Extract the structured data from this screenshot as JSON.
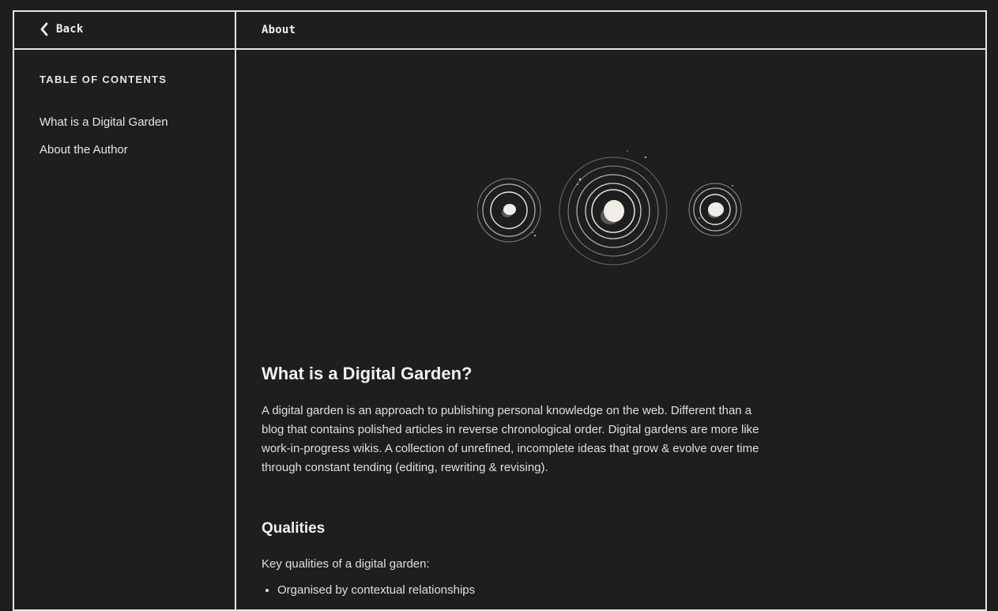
{
  "nav": {
    "back_label": "Back",
    "page_tab": "About"
  },
  "toc": {
    "heading": "TABLE OF CONTENTS",
    "items": [
      "What is a Digital Garden",
      "About the Author"
    ]
  },
  "article": {
    "title": "What is a Digital Garden?",
    "intro": "A digital garden is an approach to publishing personal knowledge on the web. Different than a blog that contains polished articles in reverse chronological order. Digital gardens are more like work-in-progress wikis. A collection of unrefined, incomplete ideas that grow & evolve over time through constant tending (editing, rewriting & revising).",
    "qualities_heading": "Qualities",
    "qualities_intro": "Key qualities of a digital garden:",
    "qualities": [
      "Organised by contextual relationships"
    ]
  },
  "hero": {
    "icon": "orbiting-planets-illustration"
  },
  "colors": {
    "background": "#1e1e1e",
    "border": "#e8e6e1",
    "text": "#e8e6e1"
  }
}
